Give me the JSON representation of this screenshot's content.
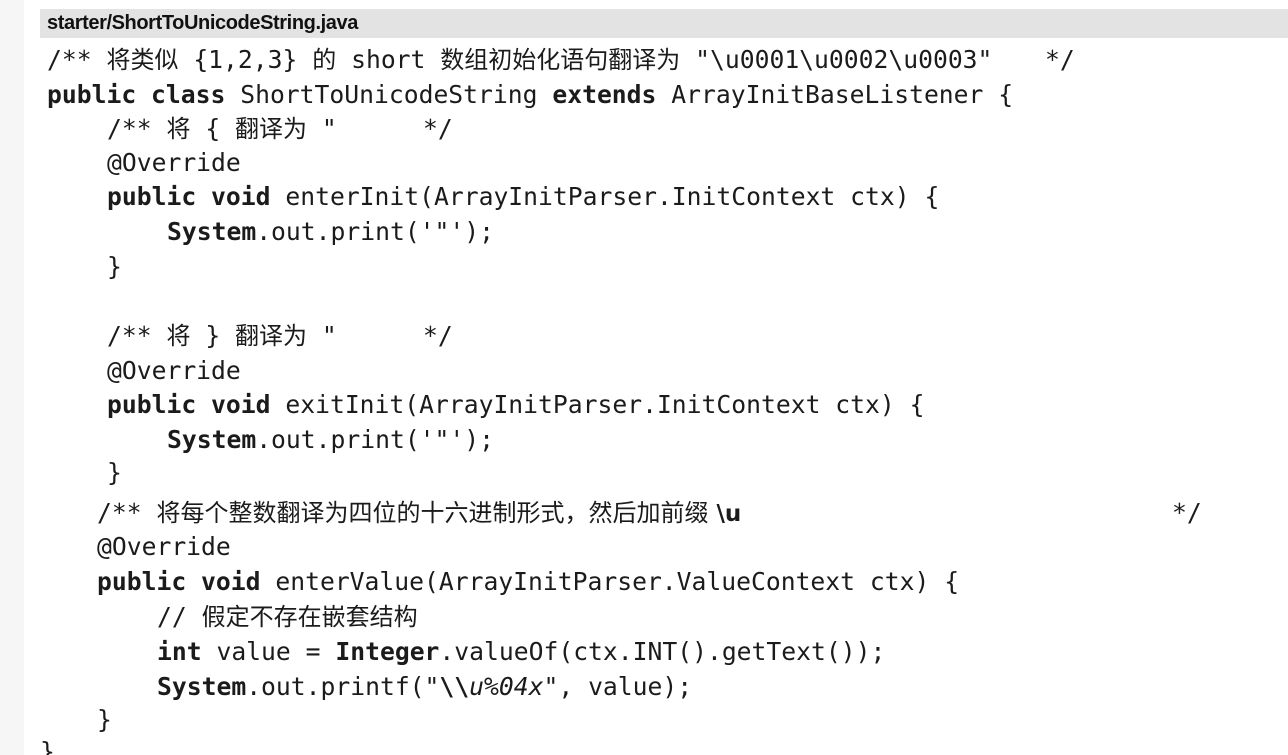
{
  "file_header": {
    "path": "starter/ShortToUnicodeString.java"
  },
  "code": {
    "lines": [
      [
        "/** ",
        "将类似",
        " {1,2,3} ",
        "的",
        " short ",
        "数组初始化语句翻译为",
        " \"\\u0001\\u0002\\u0003\"",
        "*/"
      ],
      [
        "public class",
        " ShortToUnicodeString ",
        "extends",
        " ArrayInitBaseListener {"
      ],
      [
        "/** ",
        "将",
        " { ",
        "翻译为",
        " \"",
        "*/"
      ],
      [
        "@Override"
      ],
      [
        "public void",
        " enterInit(ArrayInitParser.InitContext ctx) {"
      ],
      [
        "System",
        ".out.print('\"');"
      ],
      [
        "}"
      ],
      [
        "/** ",
        "将",
        " } ",
        "翻译为",
        " \"",
        "*/"
      ],
      [
        "@Override"
      ],
      [
        "public void",
        " exitInit(ArrayInitParser.InitContext ctx) {"
      ],
      [
        "System",
        ".out.print('\"');"
      ],
      [
        "}"
      ],
      [
        "/** ",
        "将每个整数翻译为四位的十六进制形式，然后加前缀",
        " \\u",
        "*/"
      ],
      [
        "@Override"
      ],
      [
        "public void",
        " enterValue(ArrayInitParser.ValueContext ctx) {"
      ],
      [
        "// ",
        "假定不存在嵌套结构"
      ],
      [
        "int",
        " value = ",
        "Integer",
        ".valueOf(ctx.INT().getText());"
      ],
      [
        "System",
        ".out.printf(\"",
        "\\\\",
        "u%04x",
        "\", value);"
      ],
      [
        "}"
      ],
      [
        "}"
      ]
    ]
  }
}
